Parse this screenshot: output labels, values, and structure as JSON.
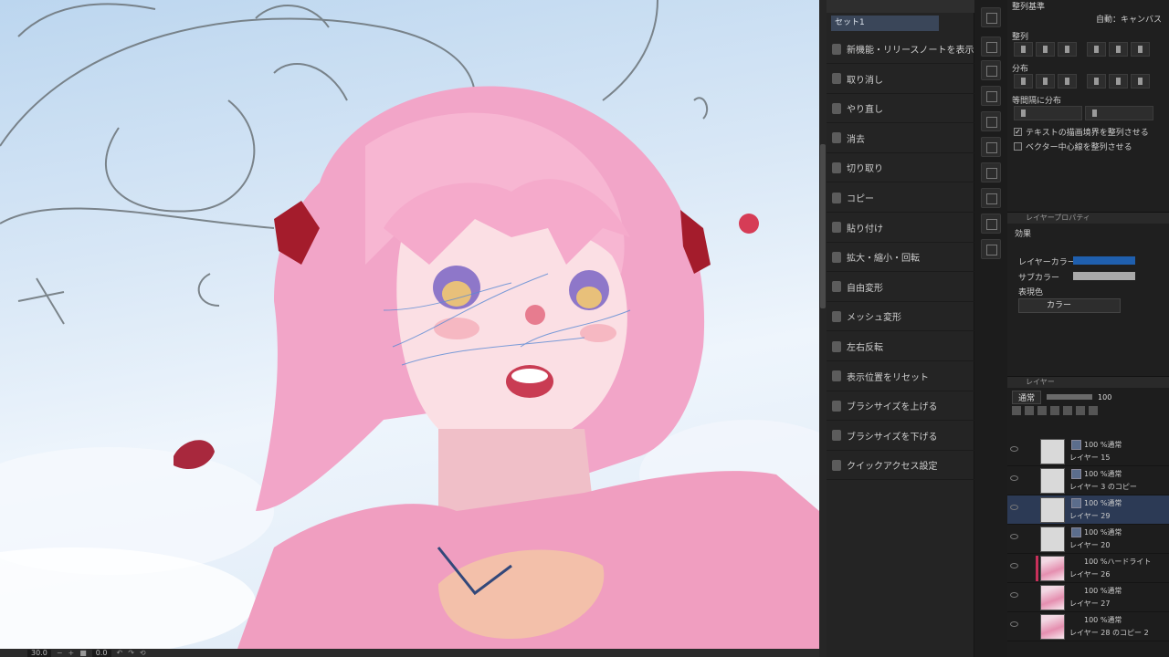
{
  "canvas": {
    "zoom_value": "30.0",
    "rotation_value": "0.0"
  },
  "menu": {
    "header": "",
    "set_label": "セット1",
    "items": [
      {
        "label": "新機能・リリースノートを表示",
        "icon": "info-icon"
      },
      {
        "label": "取り消し",
        "icon": "undo-icon"
      },
      {
        "label": "やり直し",
        "icon": "redo-icon"
      },
      {
        "label": "消去",
        "icon": "clear-icon"
      },
      {
        "label": "切り取り",
        "icon": "cut-icon"
      },
      {
        "label": "コピー",
        "icon": "copy-icon"
      },
      {
        "label": "貼り付け",
        "icon": "paste-icon"
      },
      {
        "label": "拡大・縮小・回転",
        "icon": "transform-icon"
      },
      {
        "label": "自由変形",
        "icon": "free-transform-icon"
      },
      {
        "label": "メッシュ変形",
        "icon": "mesh-transform-icon"
      },
      {
        "label": "左右反転",
        "icon": "flip-icon"
      },
      {
        "label": "表示位置をリセット",
        "icon": "reset-view-icon"
      },
      {
        "label": "ブラシサイズを上げる",
        "icon": "brush-up-icon"
      },
      {
        "label": "ブラシサイズを下げる",
        "icon": "brush-down-icon"
      },
      {
        "label": "クイックアクセス設定",
        "icon": "settings-icon"
      }
    ]
  },
  "align": {
    "basis_label": "整列基準",
    "basis_value": "自動：キャンバス",
    "align_label": "整列",
    "distribute_label": "分布",
    "equal_spacing_label": "等間隔に分布",
    "check_text_label": "テキストの描画境界を整列させる",
    "check_text_checked": "✓",
    "check_vector_label": "ベクター中心線を整列させる"
  },
  "layer_property": {
    "tab_label": "レイヤープロパティ",
    "effect_label": "効果",
    "layer_color_label": "レイヤーカラー",
    "sub_color_label": "サブカラー",
    "layer_color": "#1f5fae",
    "sub_color": "#a9a9a9",
    "expression_label": "表現色",
    "expression_value": "カラー"
  },
  "layers": {
    "tab_label": "レイヤー",
    "blend_mode": "通常",
    "opacity": "100",
    "rows": [
      {
        "mode": "100 %通常",
        "name": "レイヤー 15",
        "art": false,
        "clip": false,
        "selected": false
      },
      {
        "mode": "100 %通常",
        "name": "レイヤー 3 のコピー",
        "art": false,
        "clip": false,
        "selected": false
      },
      {
        "mode": "100 %通常",
        "name": "レイヤー 29",
        "art": false,
        "clip": false,
        "selected": true
      },
      {
        "mode": "100 %通常",
        "name": "レイヤー 20",
        "art": false,
        "clip": false,
        "selected": false
      },
      {
        "mode": "100 %ハードライト",
        "name": "レイヤー 26",
        "art": true,
        "clip": true,
        "selected": false
      },
      {
        "mode": "100 %通常",
        "name": "レイヤー 27",
        "art": true,
        "clip": false,
        "selected": false
      },
      {
        "mode": "100 %通常",
        "name": "レイヤー 28 のコピー 2",
        "art": true,
        "clip": false,
        "selected": false
      }
    ]
  }
}
